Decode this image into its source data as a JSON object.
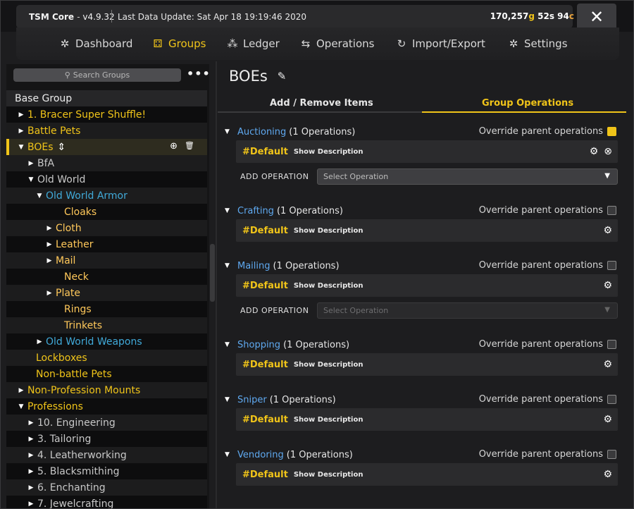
{
  "titlebar": {
    "app_name": "TSM Core",
    "version": "v4.9.32",
    "last_update": "Last Data Update: Sat Apr 18 19:19:46 2020",
    "gold": "170,257",
    "gold_unit": "g",
    "silver": "52",
    "silver_unit": "s",
    "copper": "94",
    "copper_unit": "c",
    "close_label": "✕"
  },
  "nav": [
    {
      "label": "Dashboard",
      "icon": "dashboard-icon",
      "glyph": "✲"
    },
    {
      "label": "Groups",
      "icon": "groups-icon",
      "glyph": "⚃"
    },
    {
      "label": "Ledger",
      "icon": "ledger-icon",
      "glyph": "⁂"
    },
    {
      "label": "Operations",
      "icon": "operations-icon",
      "glyph": "⇆"
    },
    {
      "label": "Import/Export",
      "icon": "import-export-icon",
      "glyph": "↻"
    },
    {
      "label": "Settings",
      "icon": "settings-icon",
      "glyph": "✲"
    }
  ],
  "sidebar": {
    "search_placeholder": "Search Groups",
    "more_label": "•••",
    "tree": [
      {
        "label": "Base Group",
        "tri": "",
        "color": "white"
      },
      {
        "label": "1. Bracer Super Shuffle!",
        "tri": "▶",
        "color": "yellow"
      },
      {
        "label": "Battle Pets",
        "tri": "▶",
        "color": "yellow"
      },
      {
        "label": "BOEs",
        "tri": "▼",
        "color": "yellow"
      },
      {
        "label": "BfA",
        "tri": "▶",
        "color": "gray"
      },
      {
        "label": "Old World",
        "tri": "▼",
        "color": "gray"
      },
      {
        "label": "Old World Armor",
        "tri": "▼",
        "color": "blue"
      },
      {
        "label": "Cloaks",
        "tri": "",
        "color": "orange"
      },
      {
        "label": "Cloth",
        "tri": "▶",
        "color": "orange"
      },
      {
        "label": "Leather",
        "tri": "▶",
        "color": "orange"
      },
      {
        "label": "Mail",
        "tri": "▶",
        "color": "orange"
      },
      {
        "label": "Neck",
        "tri": "",
        "color": "orange"
      },
      {
        "label": "Plate",
        "tri": "▶",
        "color": "orange"
      },
      {
        "label": "Rings",
        "tri": "",
        "color": "orange"
      },
      {
        "label": "Trinkets",
        "tri": "",
        "color": "orange"
      },
      {
        "label": "Old World Weapons",
        "tri": "▶",
        "color": "blue"
      },
      {
        "label": "Lockboxes",
        "tri": "",
        "color": "yellow"
      },
      {
        "label": "Non-battle Pets",
        "tri": "",
        "color": "yellow"
      },
      {
        "label": "Non-Profession Mounts",
        "tri": "▶",
        "color": "yellow"
      },
      {
        "label": "Professions",
        "tri": "▼",
        "color": "yellow"
      },
      {
        "label": "10. Engineering",
        "tri": "▶",
        "color": "gray"
      },
      {
        "label": "3. Tailoring",
        "tri": "▶",
        "color": "gray"
      },
      {
        "label": "4. Leatherworking",
        "tri": "▶",
        "color": "gray"
      },
      {
        "label": "5. Blacksmithing",
        "tri": "▶",
        "color": "gray"
      },
      {
        "label": "6. Enchanting",
        "tri": "▶",
        "color": "gray"
      },
      {
        "label": "7. Jewelcrafting",
        "tri": "▶",
        "color": "gray"
      }
    ]
  },
  "main": {
    "title": "BOEs",
    "tabs": [
      "Add / Remove Items",
      "Group Operations"
    ],
    "override_label": "Override parent operations",
    "add_operation_label": "ADD OPERATION",
    "select_placeholder": "Select Operation",
    "show_description": "Show Description",
    "sections": [
      {
        "name": "Auctioning",
        "count": "(1 Operations)",
        "op": "#Default",
        "override": true,
        "delete_icon": true,
        "add_row": "enabled"
      },
      {
        "name": "Crafting",
        "count": "(1 Operations)",
        "op": "#Default",
        "override": false,
        "delete_icon": false,
        "add_row": "none"
      },
      {
        "name": "Mailing",
        "count": "(1 Operations)",
        "op": "#Default",
        "override": false,
        "delete_icon": false,
        "add_row": "disabled"
      },
      {
        "name": "Shopping",
        "count": "(1 Operations)",
        "op": "#Default",
        "override": false,
        "delete_icon": false,
        "add_row": "none"
      },
      {
        "name": "Sniper",
        "count": "(1 Operations)",
        "op": "#Default",
        "override": false,
        "delete_icon": false,
        "add_row": "none"
      },
      {
        "name": "Vendoring",
        "count": "(1 Operations)",
        "op": "#Default",
        "override": false,
        "delete_icon": false,
        "add_row": "none"
      }
    ]
  },
  "colors": {
    "accent": "#f0c419",
    "link_blue": "#5fa9f0",
    "tree_blue": "#40a9d8"
  }
}
